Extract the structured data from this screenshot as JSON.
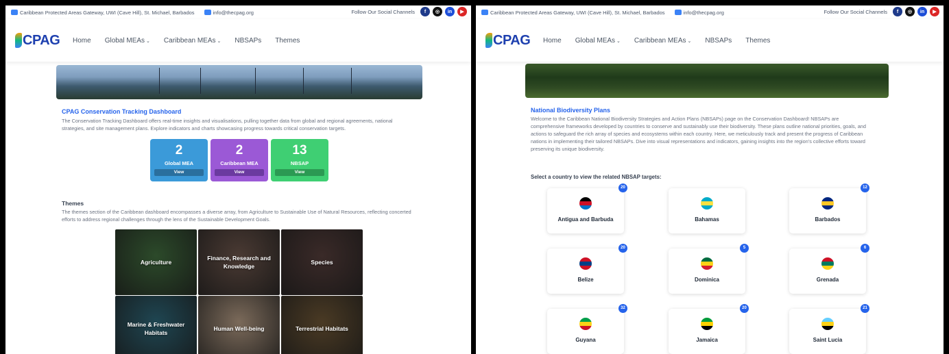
{
  "topbar": {
    "location": "Caribbean Protected Areas Gateway, UWI (Cave Hill), St. Michael, Barbados",
    "email": "info@thecpag.org",
    "social_label": "Follow Our Social Channels"
  },
  "nav": {
    "logo": "CPAG",
    "items": [
      "Home",
      "Global MEAs",
      "Caribbean MEAs",
      "NBSAPs",
      "Themes"
    ]
  },
  "left": {
    "title": "CPAG Conservation Tracking Dashboard",
    "intro": "The Conservation Tracking Dashboard offers real-time insights and visualisations, pulling together data from global and regional agreements, national strategies, and site management plans. Explore indicators and charts showcasing progress towards critical conservation targets.",
    "stats": [
      {
        "value": "2",
        "label": "Global MEA",
        "button": "View",
        "color": "#3b9ad9",
        "btn_color": "#2a6f9e"
      },
      {
        "value": "2",
        "label": "Caribbean MEA",
        "button": "View",
        "color": "#9b59d6",
        "btn_color": "#6b3aa0"
      },
      {
        "value": "13",
        "label": "NBSAP",
        "button": "View",
        "color": "#3fcf73",
        "btn_color": "#2b9a53"
      }
    ],
    "themes_title": "Themes",
    "themes_text": "The themes section of the Caribbean dashboard encompasses a diverse array, from Agriculture to Sustainable Use of Natural Resources, reflecting concerted efforts to address regional challenges through the lens of the Sustainable Development Goals.",
    "themes": [
      {
        "label": "Agriculture",
        "color": "#2c4a2a"
      },
      {
        "label": "Finance, Research and Knowledge",
        "color": "#4a3a33"
      },
      {
        "label": "Species",
        "color": "#3a2a28"
      },
      {
        "label": "Marine & Freshwater Habitats",
        "color": "#1f4652"
      },
      {
        "label": "Human Well-being",
        "color": "#7b6a5a"
      },
      {
        "label": "Terrestrial Habitats",
        "color": "#4a3a24"
      }
    ]
  },
  "right": {
    "title": "National Biodiversity Plans",
    "intro": "Welcome to the Caribbean National Biodiversity Strategies and Action Plans (NBSAPs) page on the Conservation Dashboard! NBSAPs are comprehensive frameworks developed by countries to conserve and sustainably use their biodiversity. These plans outline national priorities, goals, and actions to safeguard the rich array of species and ecosystems within each country. Here, we meticulously track and present the progress of Caribbean nations in implementing their tailored NBSAPs. Dive into visual representations and indicators, gaining insights into the region's collective efforts toward preserving its unique biodiversity.",
    "select_label": "Select a country to view the related NBSAP targets:",
    "countries": [
      {
        "name": "Antigua and Barbuda",
        "count": "20",
        "flag": [
          "#000000",
          "#ce1126",
          "#0072c6"
        ]
      },
      {
        "name": "Bahamas",
        "count": "",
        "flag": [
          "#00abc9",
          "#fae042",
          "#00abc9"
        ]
      },
      {
        "name": "Barbados",
        "count": "12",
        "flag": [
          "#00267f",
          "#ffc726",
          "#00267f"
        ]
      },
      {
        "name": "Belize",
        "count": "20",
        "flag": [
          "#ce1126",
          "#003f87",
          "#ce1126"
        ]
      },
      {
        "name": "Dominica",
        "count": "5",
        "flag": [
          "#006b3f",
          "#fcd116",
          "#d41c30"
        ]
      },
      {
        "name": "Grenada",
        "count": "6",
        "flag": [
          "#ce1126",
          "#007a5e",
          "#fcd116"
        ]
      },
      {
        "name": "Guyana",
        "count": "32",
        "flag": [
          "#009e49",
          "#fcd116",
          "#ce1126"
        ]
      },
      {
        "name": "Jamaica",
        "count": "20",
        "flag": [
          "#009b3a",
          "#fed100",
          "#000000"
        ]
      },
      {
        "name": "Saint Lucia",
        "count": "21",
        "flag": [
          "#65cfff",
          "#fcd116",
          "#000000"
        ]
      }
    ]
  }
}
